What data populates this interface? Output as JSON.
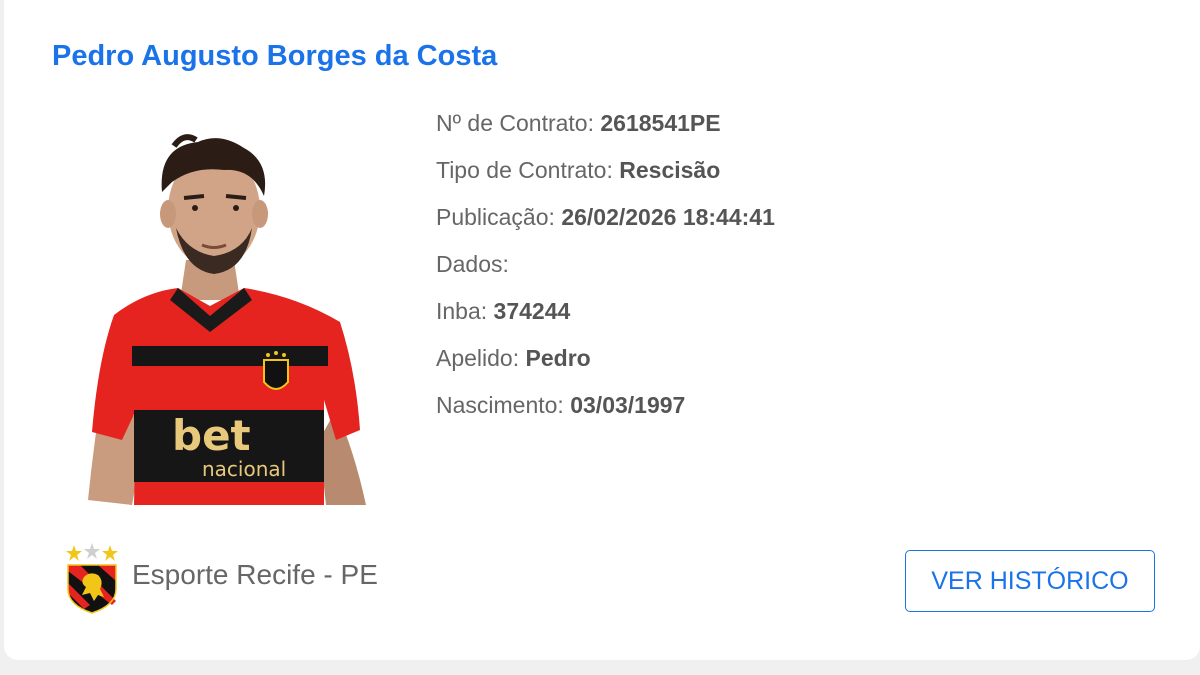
{
  "player": {
    "name": "Pedro Augusto Borges da Costa",
    "photo_sponsor_text": [
      "bet",
      "nacional"
    ]
  },
  "details": {
    "contract_number": {
      "label": "Nº de Contrato: ",
      "value": "2618541PE"
    },
    "contract_type": {
      "label": "Tipo de Contrato: ",
      "value": "Rescisão"
    },
    "publication": {
      "label": "Publicação: ",
      "value": "26/02/2026 18:44:41"
    },
    "data_header": {
      "label": "Dados:"
    },
    "inba": {
      "label": "Inba: ",
      "value": "374244"
    },
    "nickname": {
      "label": "Apelido: ",
      "value": "Pedro"
    },
    "birth": {
      "label": "Nascimento: ",
      "value": "03/03/1997"
    }
  },
  "club": {
    "name": "Esporte Recife - PE",
    "crest_icon": "sport-recife-crest-icon",
    "colors": {
      "red": "#e52420",
      "black": "#111111",
      "gold": "#f2c618"
    }
  },
  "actions": {
    "history_label": "VER HISTÓRICO"
  },
  "theme": {
    "accent": "#1a73e8",
    "text_muted": "#666666"
  }
}
